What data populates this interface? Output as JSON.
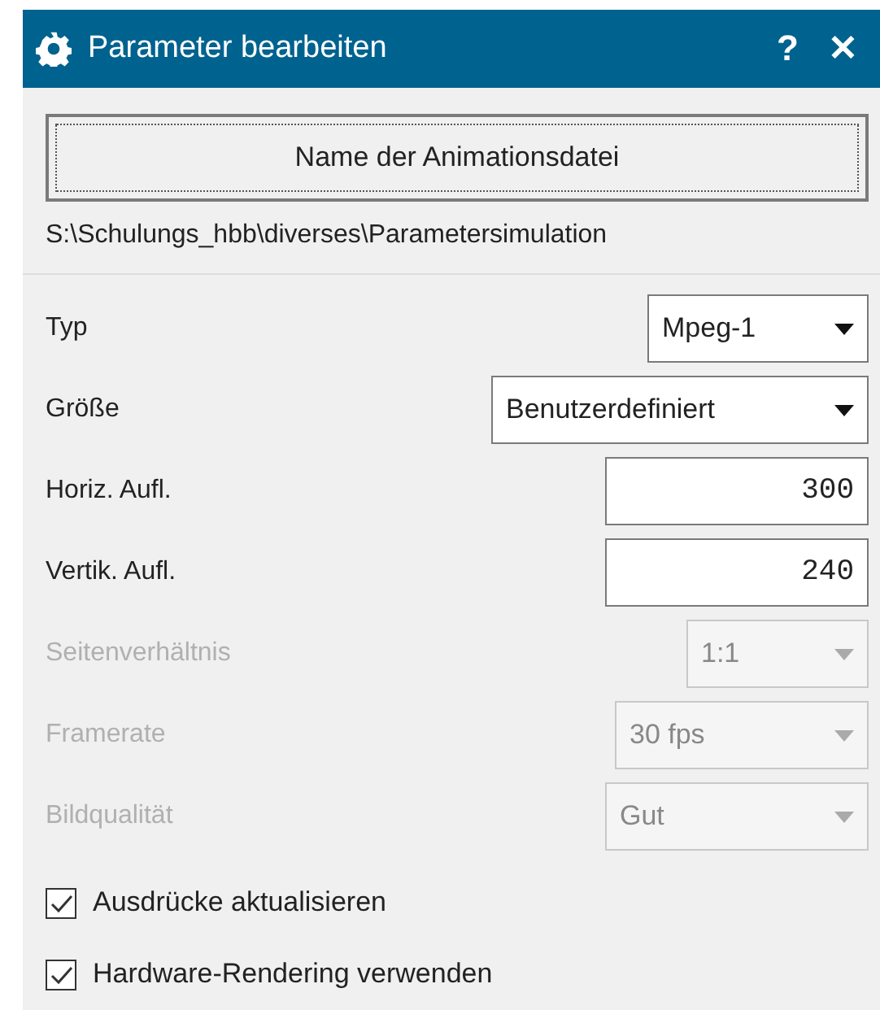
{
  "window": {
    "title": "Parameter bearbeiten",
    "help": "?",
    "close": "✕"
  },
  "file_button": "Name der Animationsdatei",
  "file_path": "S:\\Schulungs_hbb\\diverses\\Parametersimulation",
  "fields": [
    {
      "kind": "dropdown",
      "label": "Typ",
      "value": "Mpeg-1",
      "disabled": false
    },
    {
      "kind": "dropdown",
      "label": "Größe",
      "value": "Benutzerdefiniert",
      "disabled": false
    },
    {
      "kind": "text",
      "label": "Horiz. Aufl.",
      "value": "300",
      "disabled": false
    },
    {
      "kind": "text",
      "label": "Vertik. Aufl.",
      "value": "240",
      "disabled": false
    },
    {
      "kind": "dropdown",
      "label": "Seitenverhältnis",
      "value": "1:1",
      "disabled": true
    },
    {
      "kind": "dropdown",
      "label": "Framerate",
      "value": "30 fps",
      "disabled": true
    },
    {
      "kind": "dropdown",
      "label": "Bildqualität",
      "value": "Gut",
      "disabled": true
    }
  ],
  "checkboxes": [
    {
      "label": "Ausdrücke aktualisieren",
      "checked": true
    },
    {
      "label": "Hardware-Rendering verwenden",
      "checked": true
    }
  ]
}
